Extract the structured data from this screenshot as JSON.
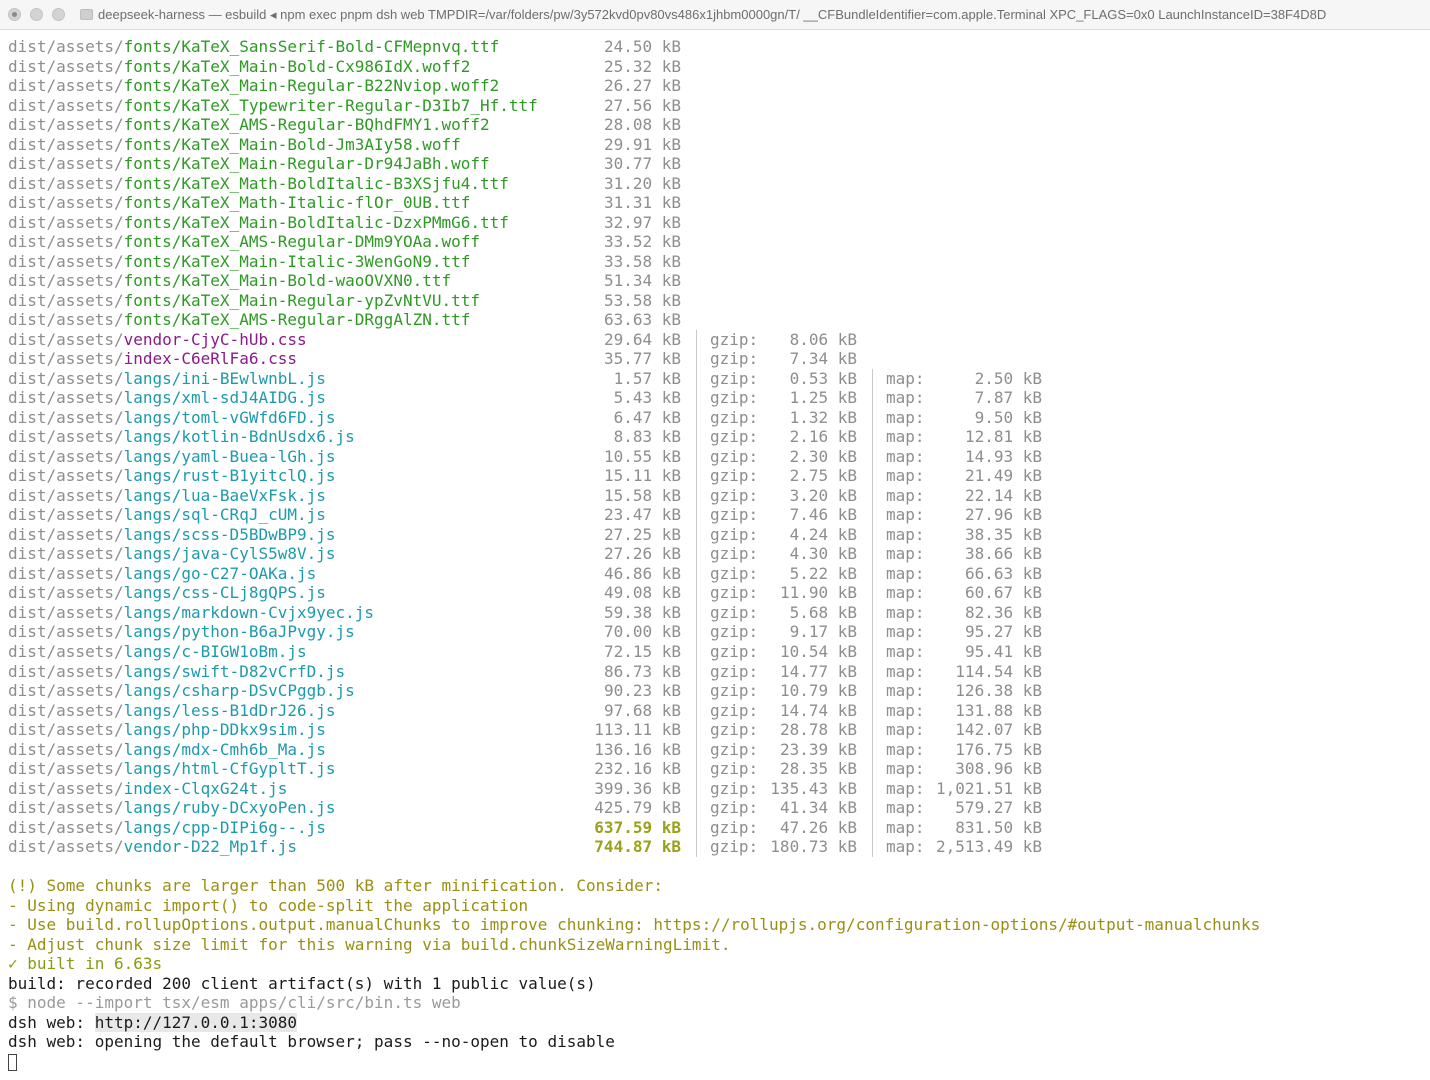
{
  "window": {
    "title": "deepseek-harness — esbuild ◂ npm exec pnpm dsh web TMPDIR=/var/folders/pw/3y572kvd0pv80vs486x1jhbm0000gn/T/ __CFBundleIdentifier=com.apple.Terminal XPC_FLAGS=0x0 LaunchInstanceID=38F4D8D"
  },
  "labels": {
    "gzip": "gzip:",
    "map": "map:"
  },
  "rows": [
    {
      "dir": "dist/assets/",
      "file": "fonts/KaTeX_SansSerif-Bold-CFMepnvq.ttf",
      "kind": "font",
      "size": "24.50 kB"
    },
    {
      "dir": "dist/assets/",
      "file": "fonts/KaTeX_Main-Bold-Cx986IdX.woff2",
      "kind": "font",
      "size": "25.32 kB"
    },
    {
      "dir": "dist/assets/",
      "file": "fonts/KaTeX_Main-Regular-B22Nviop.woff2",
      "kind": "font",
      "size": "26.27 kB"
    },
    {
      "dir": "dist/assets/",
      "file": "fonts/KaTeX_Typewriter-Regular-D3Ib7_Hf.ttf",
      "kind": "font",
      "size": "27.56 kB"
    },
    {
      "dir": "dist/assets/",
      "file": "fonts/KaTeX_AMS-Regular-BQhdFMY1.woff2",
      "kind": "font",
      "size": "28.08 kB"
    },
    {
      "dir": "dist/assets/",
      "file": "fonts/KaTeX_Main-Bold-Jm3AIy58.woff",
      "kind": "font",
      "size": "29.91 kB"
    },
    {
      "dir": "dist/assets/",
      "file": "fonts/KaTeX_Main-Regular-Dr94JaBh.woff",
      "kind": "font",
      "size": "30.77 kB"
    },
    {
      "dir": "dist/assets/",
      "file": "fonts/KaTeX_Math-BoldItalic-B3XSjfu4.ttf",
      "kind": "font",
      "size": "31.20 kB"
    },
    {
      "dir": "dist/assets/",
      "file": "fonts/KaTeX_Math-Italic-flOr_0UB.ttf",
      "kind": "font",
      "size": "31.31 kB"
    },
    {
      "dir": "dist/assets/",
      "file": "fonts/KaTeX_Main-BoldItalic-DzxPMmG6.ttf",
      "kind": "font",
      "size": "32.97 kB"
    },
    {
      "dir": "dist/assets/",
      "file": "fonts/KaTeX_AMS-Regular-DMm9YOAa.woff",
      "kind": "font",
      "size": "33.52 kB"
    },
    {
      "dir": "dist/assets/",
      "file": "fonts/KaTeX_Main-Italic-3WenGoN9.ttf",
      "kind": "font",
      "size": "33.58 kB"
    },
    {
      "dir": "dist/assets/",
      "file": "fonts/KaTeX_Main-Bold-waoOVXN0.ttf",
      "kind": "font",
      "size": "51.34 kB"
    },
    {
      "dir": "dist/assets/",
      "file": "fonts/KaTeX_Main-Regular-ypZvNtVU.ttf",
      "kind": "font",
      "size": "53.58 kB"
    },
    {
      "dir": "dist/assets/",
      "file": "fonts/KaTeX_AMS-Regular-DRggAlZN.ttf",
      "kind": "font",
      "size": "63.63 kB"
    },
    {
      "dir": "dist/assets/",
      "file": "vendor-CjyC-hUb.css",
      "kind": "css",
      "size": "29.64 kB",
      "gzip": "8.06 kB"
    },
    {
      "dir": "dist/assets/",
      "file": "index-C6eRlFa6.css",
      "kind": "css",
      "size": "35.77 kB",
      "gzip": "7.34 kB"
    },
    {
      "dir": "dist/assets/",
      "file": "langs/ini-BEwlwnbL.js",
      "kind": "js",
      "size": "1.57 kB",
      "gzip": "0.53 kB",
      "map": "2.50 kB"
    },
    {
      "dir": "dist/assets/",
      "file": "langs/xml-sdJ4AIDG.js",
      "kind": "js",
      "size": "5.43 kB",
      "gzip": "1.25 kB",
      "map": "7.87 kB"
    },
    {
      "dir": "dist/assets/",
      "file": "langs/toml-vGWfd6FD.js",
      "kind": "js",
      "size": "6.47 kB",
      "gzip": "1.32 kB",
      "map": "9.50 kB"
    },
    {
      "dir": "dist/assets/",
      "file": "langs/kotlin-BdnUsdx6.js",
      "kind": "js",
      "size": "8.83 kB",
      "gzip": "2.16 kB",
      "map": "12.81 kB"
    },
    {
      "dir": "dist/assets/",
      "file": "langs/yaml-Buea-lGh.js",
      "kind": "js",
      "size": "10.55 kB",
      "gzip": "2.30 kB",
      "map": "14.93 kB"
    },
    {
      "dir": "dist/assets/",
      "file": "langs/rust-B1yitclQ.js",
      "kind": "js",
      "size": "15.11 kB",
      "gzip": "2.75 kB",
      "map": "21.49 kB"
    },
    {
      "dir": "dist/assets/",
      "file": "langs/lua-BaeVxFsk.js",
      "kind": "js",
      "size": "15.58 kB",
      "gzip": "3.20 kB",
      "map": "22.14 kB"
    },
    {
      "dir": "dist/assets/",
      "file": "langs/sql-CRqJ_cUM.js",
      "kind": "js",
      "size": "23.47 kB",
      "gzip": "7.46 kB",
      "map": "27.96 kB"
    },
    {
      "dir": "dist/assets/",
      "file": "langs/scss-D5BDwBP9.js",
      "kind": "js",
      "size": "27.25 kB",
      "gzip": "4.24 kB",
      "map": "38.35 kB"
    },
    {
      "dir": "dist/assets/",
      "file": "langs/java-CylS5w8V.js",
      "kind": "js",
      "size": "27.26 kB",
      "gzip": "4.30 kB",
      "map": "38.66 kB"
    },
    {
      "dir": "dist/assets/",
      "file": "langs/go-C27-OAKa.js",
      "kind": "js",
      "size": "46.86 kB",
      "gzip": "5.22 kB",
      "map": "66.63 kB"
    },
    {
      "dir": "dist/assets/",
      "file": "langs/css-CLj8gQPS.js",
      "kind": "js",
      "size": "49.08 kB",
      "gzip": "11.90 kB",
      "map": "60.67 kB"
    },
    {
      "dir": "dist/assets/",
      "file": "langs/markdown-Cvjx9yec.js",
      "kind": "js",
      "size": "59.38 kB",
      "gzip": "5.68 kB",
      "map": "82.36 kB"
    },
    {
      "dir": "dist/assets/",
      "file": "langs/python-B6aJPvgy.js",
      "kind": "js",
      "size": "70.00 kB",
      "gzip": "9.17 kB",
      "map": "95.27 kB"
    },
    {
      "dir": "dist/assets/",
      "file": "langs/c-BIGW1oBm.js",
      "kind": "js",
      "size": "72.15 kB",
      "gzip": "10.54 kB",
      "map": "95.41 kB"
    },
    {
      "dir": "dist/assets/",
      "file": "langs/swift-D82vCrfD.js",
      "kind": "js",
      "size": "86.73 kB",
      "gzip": "14.77 kB",
      "map": "114.54 kB"
    },
    {
      "dir": "dist/assets/",
      "file": "langs/csharp-DSvCPggb.js",
      "kind": "js",
      "size": "90.23 kB",
      "gzip": "10.79 kB",
      "map": "126.38 kB"
    },
    {
      "dir": "dist/assets/",
      "file": "langs/less-B1dDrJ26.js",
      "kind": "js",
      "size": "97.68 kB",
      "gzip": "14.74 kB",
      "map": "131.88 kB"
    },
    {
      "dir": "dist/assets/",
      "file": "langs/php-DDkx9sim.js",
      "kind": "js",
      "size": "113.11 kB",
      "gzip": "28.78 kB",
      "map": "142.07 kB"
    },
    {
      "dir": "dist/assets/",
      "file": "langs/mdx-Cmh6b_Ma.js",
      "kind": "js",
      "size": "136.16 kB",
      "gzip": "23.39 kB",
      "map": "176.75 kB"
    },
    {
      "dir": "dist/assets/",
      "file": "langs/html-CfGypltT.js",
      "kind": "js",
      "size": "232.16 kB",
      "gzip": "28.35 kB",
      "map": "308.96 kB"
    },
    {
      "dir": "dist/assets/",
      "file": "index-ClqxG24t.js",
      "kind": "js",
      "size": "399.36 kB",
      "gzip": "135.43 kB",
      "map": "1,021.51 kB"
    },
    {
      "dir": "dist/assets/",
      "file": "langs/ruby-DCxyoPen.js",
      "kind": "js",
      "size": "425.79 kB",
      "gzip": "41.34 kB",
      "map": "579.27 kB"
    },
    {
      "dir": "dist/assets/",
      "file": "langs/cpp-DIPi6g--.js",
      "kind": "js",
      "size": "637.59 kB",
      "big": true,
      "gzip": "47.26 kB",
      "map": "831.50 kB"
    },
    {
      "dir": "dist/assets/",
      "file": "vendor-D22_Mp1f.js",
      "kind": "js",
      "size": "744.87 kB",
      "big": true,
      "gzip": "180.73 kB",
      "map": "2,513.49 kB"
    }
  ],
  "warning": {
    "l1": "(!) Some chunks are larger than 500 kB after minification. Consider:",
    "l2": "- Using dynamic import() to code-split the application",
    "l3": "- Use build.rollupOptions.output.manualChunks to improve chunking: https://rollupjs.org/configuration-options/#output-manualchunks",
    "l4": "- Adjust chunk size limit for this warning via build.chunkSizeWarningLimit."
  },
  "built": "✓ built in 6.63s",
  "recorded": "build: recorded 200 client artifact(s) with 1 public value(s)",
  "command": "$ node --import tsx/esm apps/cli/src/bin.ts web",
  "dsh_prefix": "dsh web: ",
  "dsh_url": "http://127.0.0.1:3080",
  "dsh_opening": "dsh web: opening the default browser; pass --no-open to disable"
}
